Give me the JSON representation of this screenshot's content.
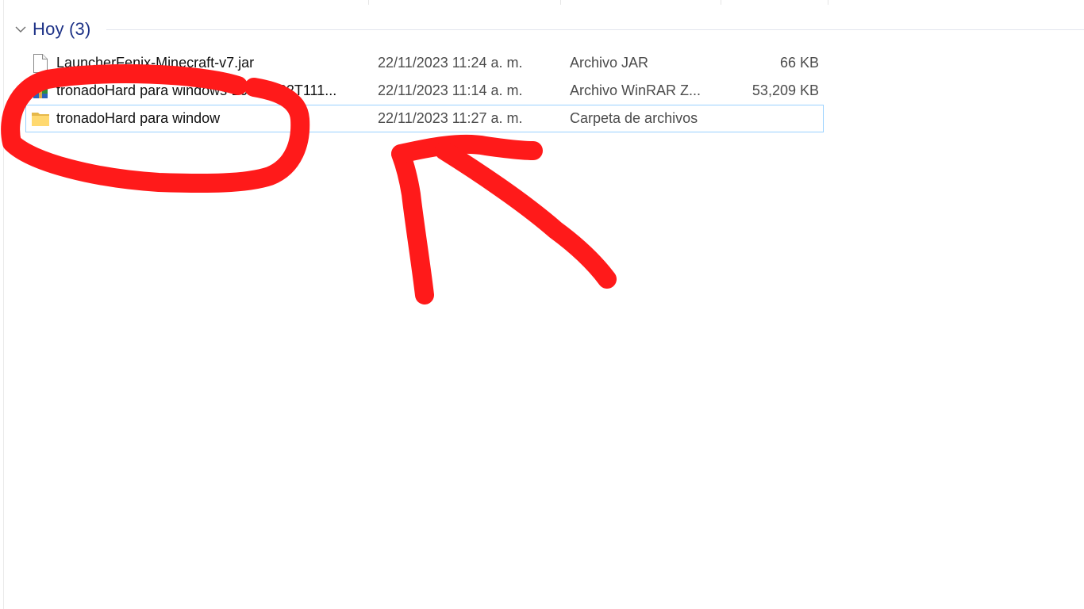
{
  "group": {
    "title": "Hoy (3)",
    "expanded_icon": "chevron-down-icon"
  },
  "files": [
    {
      "name": "LauncherFenix-Minecraft-v7.jar",
      "date": "22/11/2023 11:24 a. m.",
      "type": "Archivo JAR",
      "size": "66 KB",
      "icon": "document-icon",
      "selected": false
    },
    {
      "name": "tronadoHard para windows-20231122T111...",
      "date": "22/11/2023 11:14 a. m.",
      "type": "Archivo WinRAR Z...",
      "size": "53,209 KB",
      "icon": "winrar-archive-icon",
      "selected": false
    },
    {
      "name": "tronadoHard para window",
      "date": "22/11/2023 11:27 a. m.",
      "type": "Carpeta de archivos",
      "size": "",
      "icon": "folder-icon",
      "selected": true
    }
  ],
  "colors": {
    "group_title": "#1e3287",
    "selection_border": "#99d1ff",
    "annotation": "#ff1a1a"
  }
}
